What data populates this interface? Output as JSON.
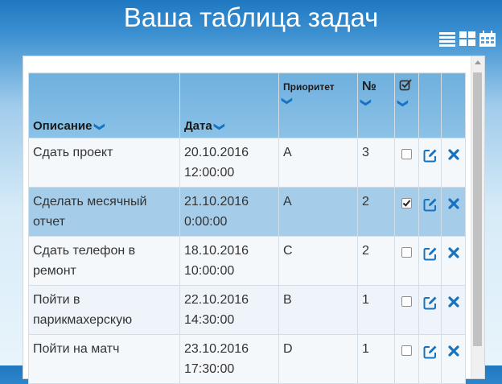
{
  "page": {
    "title": "Ваша таблица задач"
  },
  "view_toggle": {
    "icons": [
      "list-view-icon",
      "grid-view-icon",
      "calendar-view-icon"
    ]
  },
  "table": {
    "columns": [
      {
        "label": "Описание"
      },
      {
        "label": "Дата"
      },
      {
        "label": "Приоритет"
      },
      {
        "label": "№"
      },
      {
        "label": ""
      },
      {
        "label": ""
      }
    ],
    "rows": [
      {
        "description": "Сдать проект",
        "date_line1": "20.10.2016",
        "date_line2": "12:00:00",
        "priority": "A",
        "number": "3",
        "done": false
      },
      {
        "description": "Сделать месячный отчет",
        "date_line1": "21.10.2016",
        "date_line2": "0:00:00",
        "priority": "A",
        "number": "2",
        "done": true
      },
      {
        "description": "Сдать телефон в ремонт",
        "date_line1": "18.10.2016",
        "date_line2": "10:00:00",
        "priority": "C",
        "number": "2",
        "done": false
      },
      {
        "description": "Пойти в парикмахерскую",
        "date_line1": "22.10.2016",
        "date_line2": "14:30:00",
        "priority": "B",
        "number": "1",
        "done": false
      },
      {
        "description": "Пойти на матч",
        "date_line1": "23.10.2016",
        "date_line2": "17:30:00",
        "priority": "D",
        "number": "1",
        "done": false
      }
    ]
  },
  "colors": {
    "accent": "#1773c0",
    "header_bg": "#7ab8e3",
    "highlight_row": "#a5cdea"
  }
}
